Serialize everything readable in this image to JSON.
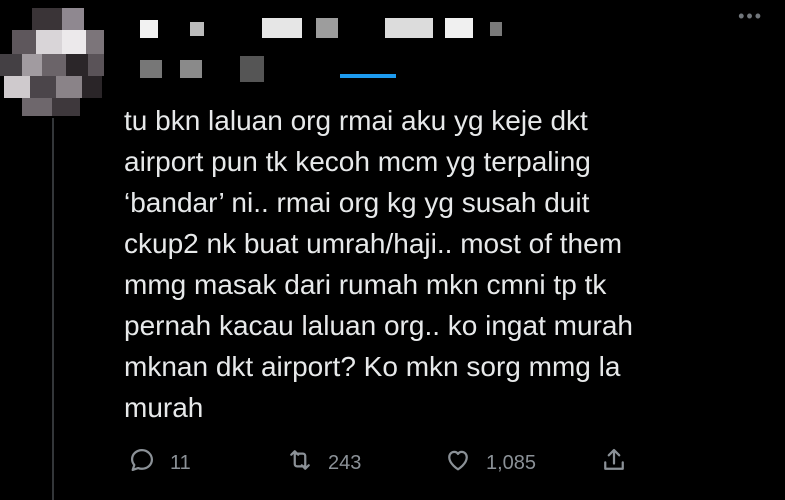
{
  "tweet": {
    "text": "tu bkn laluan org rmai aku yg keje dkt\nairport pun tk kecoh mcm yg terpaling\n‘bandar’ ni.. rmai org kg yg susah duit\nckup2 nk buat umrah/haji.. most of them\nmmg masak dari rumah mkn cmni tp tk\npernah kacau laluan org.. ko ingat murah\nmknan dkt airport? Ko mkn sorg mmg la\nmurah"
  },
  "actions": {
    "reply": {
      "icon": "reply-icon",
      "count": "11"
    },
    "retweet": {
      "icon": "retweet-icon",
      "count": "243"
    },
    "like": {
      "icon": "heart-icon",
      "count": "1,085"
    },
    "share": {
      "icon": "share-icon"
    }
  },
  "menu": {
    "icon": "more-icon"
  },
  "colors": {
    "background": "#000000",
    "text": "#e7e9ea",
    "muted": "#8b9197"
  }
}
